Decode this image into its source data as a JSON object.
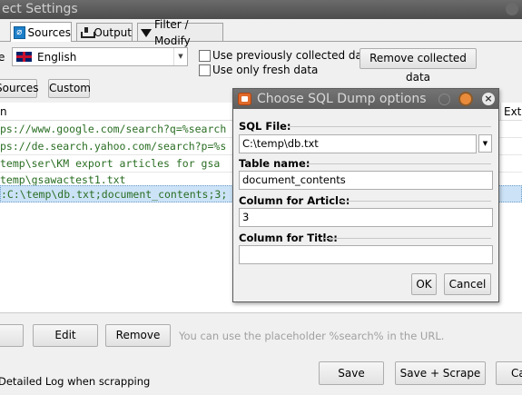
{
  "window": {
    "title": "ect Settings"
  },
  "tabs": [
    {
      "label": "Sources",
      "icon": "sources-icon"
    },
    {
      "label": "Output",
      "icon": "output-icon"
    },
    {
      "label": "Filter / Modify",
      "icon": "filter-icon"
    }
  ],
  "language": {
    "label": "e",
    "selected": "English"
  },
  "options": {
    "use_previous": "Use previously collected data",
    "use_fresh": "Use only fresh data",
    "remove_collected": "Remove collected data"
  },
  "source_buttons": {
    "sources": "Sources",
    "custom": "Custom"
  },
  "table": {
    "columns": [
      "n",
      "Extr"
    ],
    "rows": [
      "ps://www.google.com/search?q=%search",
      "ps://de.search.yahoo.com/search?p=%s",
      "temp\\ser\\KM export articles for gsa",
      "temp\\gsawactest1.txt",
      ":C:\\temp\\db.txt;document_contents;3;"
    ]
  },
  "bottom": {
    "edit": "Edit",
    "remove": "Remove",
    "hint": "You can use the placeholder %search% in the URL.",
    "detailed_log": "Detailed Log when scrapping",
    "save": "Save",
    "save_scrape": "Save + Scrape",
    "cancel": "Ca"
  },
  "dialog": {
    "title": "Choose SQL Dump options",
    "sql_file_label": "SQL File:",
    "sql_file_value": "C:\\temp\\db.txt",
    "table_name_label": "Table name:",
    "table_name_value": "document_contents",
    "article_label": "Column for Article:",
    "article_value": "3",
    "title_label": "Column for Title:",
    "title_value": "",
    "ok": "OK",
    "cancel": "Cancel"
  }
}
